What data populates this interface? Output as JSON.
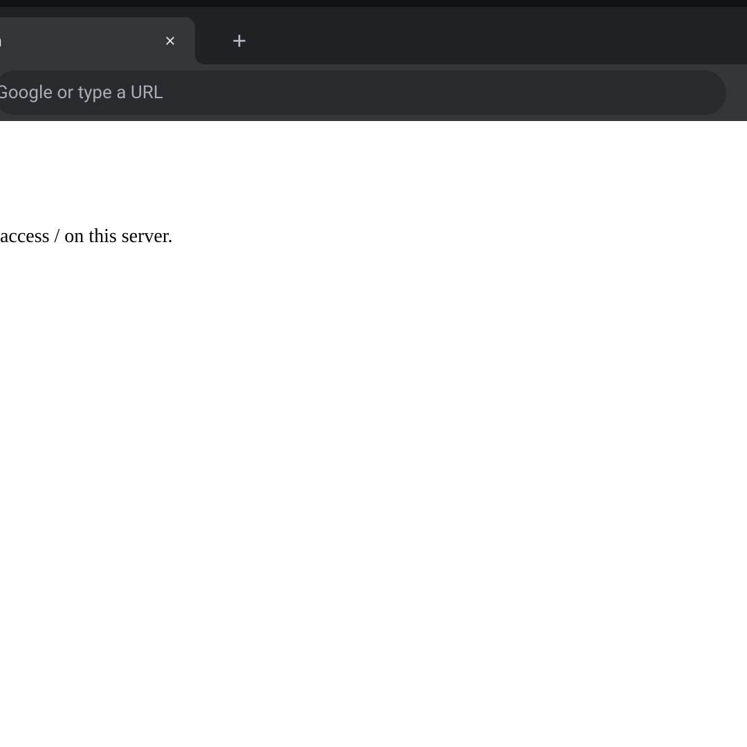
{
  "tab": {
    "title_fragment": "n"
  },
  "omnibox": {
    "placeholder": "Google or type a URL"
  },
  "page": {
    "body_fragment": " access / on this server."
  }
}
